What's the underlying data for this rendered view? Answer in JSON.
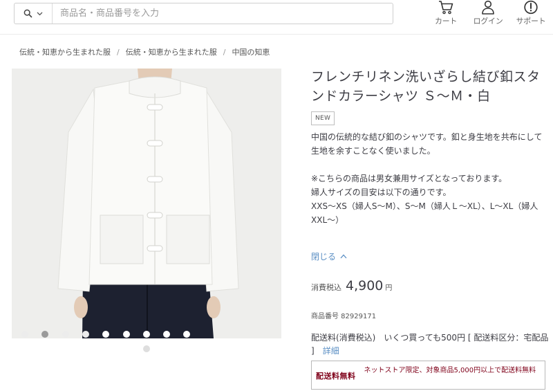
{
  "search": {
    "placeholder": "商品名・商品番号を入力",
    "scope_icon": "search-icon"
  },
  "nav": {
    "cart_label": "カート",
    "login_label": "ログイン",
    "support_label": "サポート"
  },
  "breadcrumb": {
    "items": [
      "伝統・知恵から生まれた服",
      "伝統・知恵から生まれた服",
      "中国の知恵"
    ]
  },
  "gallery": {
    "dot_count": 9,
    "active_dot": 2
  },
  "product": {
    "title": "フレンチリネン洗いざらし結び釦スタンドカラーシャツ Ｓ～Ｍ・白",
    "badge": "NEW",
    "desc_1": "中国の伝統的な結び釦のシャツです。釦と身生地を共布にして生地を余すことなく使いました。",
    "desc_2": "※こちらの商品は男女兼用サイズとなっております。",
    "desc_3": "婦人サイズの目安は以下の通りです。",
    "desc_4": "XXS～XS（婦人S～M）、S～M（婦人Ｌ～XL）、L～XL（婦人XXL～）",
    "close_label": "閉じる",
    "price_label": "消費税込",
    "price": "4,900",
    "price_unit": "円",
    "sku": "商品番号 82929171",
    "shipping_text": "配送料(消費税込)　いくつ買っても500円 [ 配送料区分：宅配品 ]",
    "shipping_link": "詳細",
    "free_ship_title": "配送料無料",
    "free_ship_text": "ネットストア限定、対象商品5,000円以上で配送料無料"
  },
  "colors": {
    "accent_link": "#5b8fc4",
    "free_ship_red": "#7f0019",
    "image_bg": "#eeeeec"
  }
}
